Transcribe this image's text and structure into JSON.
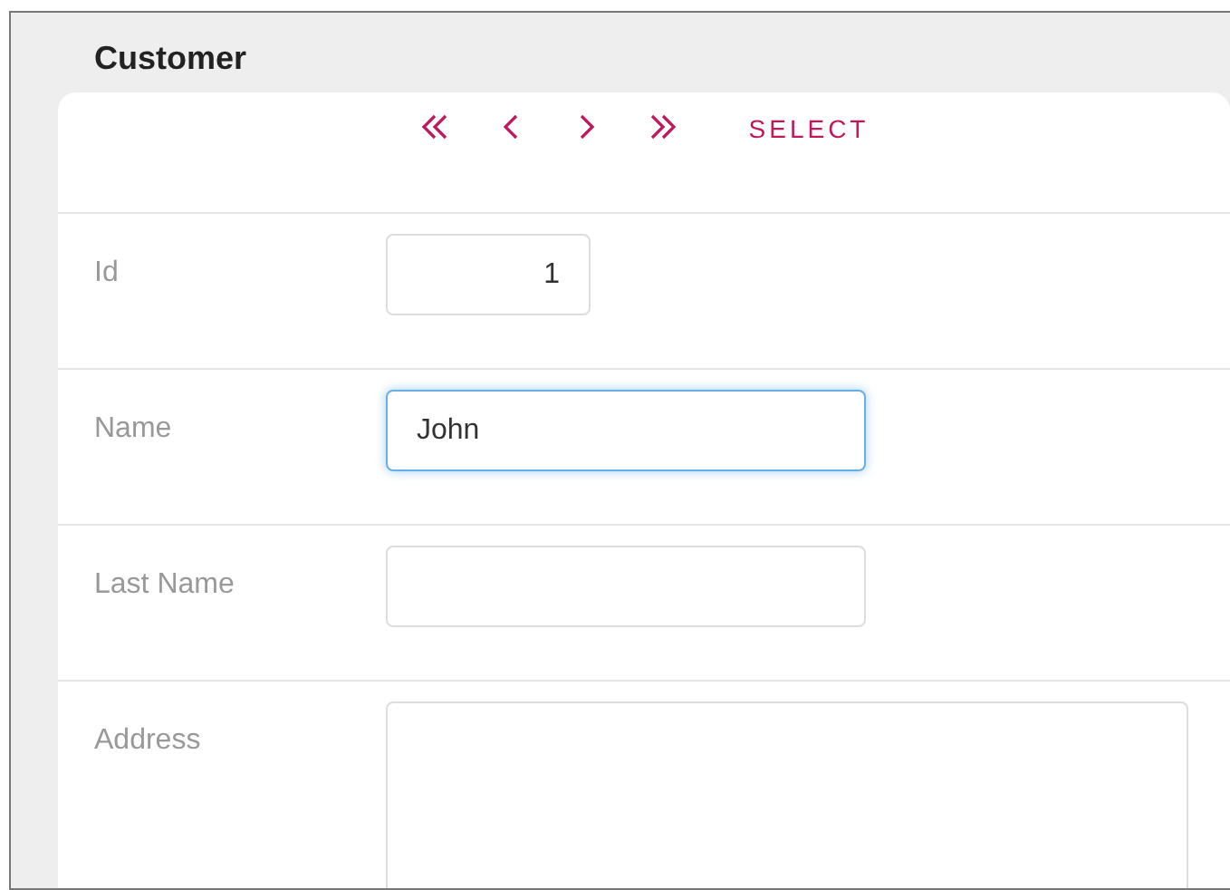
{
  "title": "Customer",
  "navigator": {
    "buttons": [
      {
        "kind": "first"
      },
      {
        "kind": "previous"
      },
      {
        "kind": "next"
      },
      {
        "kind": "last"
      }
    ],
    "action": "SELECT"
  },
  "fields": [
    {
      "label": "Id",
      "kind": "number",
      "value": "1",
      "focused": false
    },
    {
      "label": "Name",
      "kind": "text",
      "value": "John",
      "focused": true
    },
    {
      "label": "Last Name",
      "kind": "text",
      "focused": false
    },
    {
      "label": "Address",
      "kind": "textarea",
      "focused": false
    }
  ]
}
